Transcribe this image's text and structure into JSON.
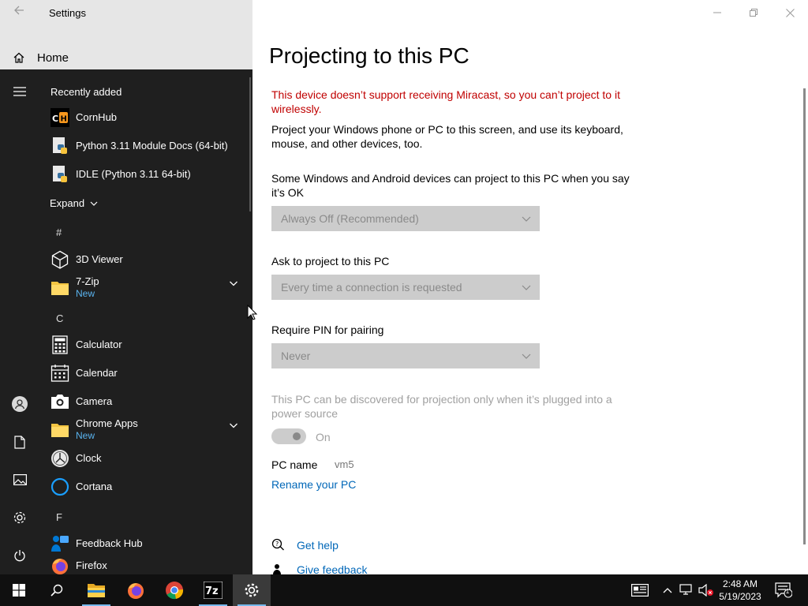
{
  "window": {
    "title": "Settings",
    "home_label": "Home"
  },
  "main": {
    "page_title": "Projecting to this PC",
    "error_message": "This device doesn’t support receiving Miracast, so you can’t project to it wirelessly.",
    "description": "Project your Windows phone or PC to this screen, and use its keyboard, mouse, and other devices, too.",
    "setting1_label": "Some Windows and Android devices can project to this PC when you say it’s OK",
    "setting1_value": "Always Off (Recommended)",
    "setting2_label": "Ask to project to this PC",
    "setting2_value": "Every time a connection is requested",
    "setting3_label": "Require PIN for pairing",
    "setting3_value": "Never",
    "discover_note": "This PC can be discovered for projection only when it’s plugged into a power source",
    "toggle_label": "On",
    "pc_name_label": "PC name",
    "pc_name_value": "vm5",
    "rename_link": "Rename your PC",
    "help_link": "Get help",
    "feedback_link": "Give feedback"
  },
  "start_menu": {
    "recently_added": "Recently added",
    "expand": "Expand",
    "letters": [
      "#",
      "C",
      "F"
    ],
    "apps": [
      {
        "name": "CornHub",
        "icon": "cornhub-icon"
      },
      {
        "name": "Python 3.11 Module Docs (64-bit)",
        "icon": "python-docs-icon"
      },
      {
        "name": "IDLE (Python 3.11 64-bit)",
        "icon": "idle-icon"
      },
      {
        "name": "3D Viewer",
        "icon": "cube-icon"
      },
      {
        "name": "7-Zip",
        "badge": "New",
        "icon": "folder-icon"
      },
      {
        "name": "Calculator",
        "icon": "calculator-icon"
      },
      {
        "name": "Calendar",
        "icon": "calendar-icon"
      },
      {
        "name": "Camera",
        "icon": "camera-icon"
      },
      {
        "name": "Chrome Apps",
        "badge": "New",
        "icon": "folder-icon"
      },
      {
        "name": "Clock",
        "icon": "clock-icon"
      },
      {
        "name": "Cortana",
        "icon": "cortana-icon"
      },
      {
        "name": "Feedback Hub",
        "icon": "feedback-hub-icon"
      },
      {
        "name": "Firefox",
        "icon": "firefox-icon"
      }
    ]
  },
  "taskbar": {
    "time": "2:48 AM",
    "date": "5/19/2023",
    "notification_count": "1"
  },
  "colors": {
    "error": "#c00000",
    "link": "#0067b8",
    "start_bg": "#1f1f1f",
    "taskbar_bg": "#101010",
    "new_badge": "#5ab4f0"
  }
}
